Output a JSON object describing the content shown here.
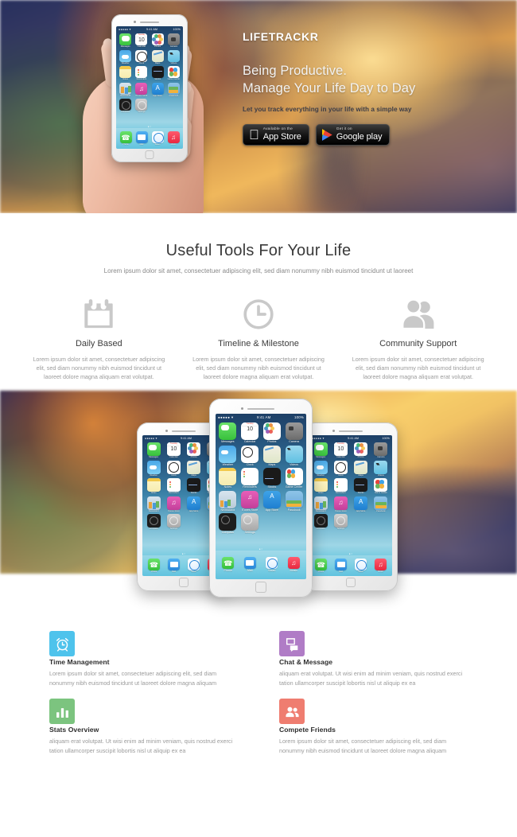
{
  "hero": {
    "brand": "LIFETRACKR",
    "headline_line1": "Being Productive.",
    "headline_line2": "Manage Your Life Day to Day",
    "subline": "Let you track everything in your life with a simple way",
    "app_store": {
      "small": "Available on the",
      "big": "App Store",
      "icon": "apple-icon"
    },
    "google_play": {
      "small": "Get it on",
      "big": "Google play",
      "icon": "google-play-icon"
    },
    "phone_image": "hand-holding-iphone"
  },
  "ios_screen": {
    "status_left": "●●●●● ▾",
    "status_time": "9:41 AM",
    "status_right": "100%",
    "page_dots": "● ○",
    "calendar_day": "10",
    "calendar_weekday": "Tuesday",
    "apps": [
      {
        "label": "Messages",
        "icon": "messages-icon"
      },
      {
        "label": "Calendar",
        "icon": "calendar-icon"
      },
      {
        "label": "Photos",
        "icon": "photos-icon"
      },
      {
        "label": "Camera",
        "icon": "camera-icon"
      },
      {
        "label": "Weather",
        "icon": "weather-icon"
      },
      {
        "label": "Clock",
        "icon": "clock-icon"
      },
      {
        "label": "Maps",
        "icon": "maps-icon"
      },
      {
        "label": "Videos",
        "icon": "videos-icon"
      },
      {
        "label": "Notes",
        "icon": "notes-icon"
      },
      {
        "label": "Reminders",
        "icon": "reminders-icon"
      },
      {
        "label": "Stocks",
        "icon": "stocks-icon"
      },
      {
        "label": "Game Center",
        "icon": "game-center-icon"
      },
      {
        "label": "Newsstand",
        "icon": "newsstand-icon"
      },
      {
        "label": "iTunes Store",
        "icon": "itunes-store-icon"
      },
      {
        "label": "App Store",
        "icon": "app-store-icon"
      },
      {
        "label": "Passbook",
        "icon": "passbook-icon"
      },
      {
        "label": "Compass",
        "icon": "compass-icon"
      },
      {
        "label": "Settings",
        "icon": "settings-icon"
      }
    ],
    "dock": [
      {
        "label": "Phone",
        "icon": "phone-icon"
      },
      {
        "label": "Mail",
        "icon": "mail-icon"
      },
      {
        "label": "Safari",
        "icon": "safari-icon"
      },
      {
        "label": "Music",
        "icon": "music-icon"
      }
    ]
  },
  "tools": {
    "title": "Useful Tools For Your Life",
    "lead": "Lorem ipsum dolor sit amet, consectetuer adipiscing elit, sed diam nonummy nibh euismod tincidunt ut laoreet",
    "items": [
      {
        "icon": "calendar-outline-icon",
        "title": "Daily Based",
        "text": "Lorem ipsum dolor sit amet, consectetuer adipiscing elit, sed diam nonummy nibh euismod tincidunt ut laoreet dolore magna aliquam erat volutpat."
      },
      {
        "icon": "clock-outline-icon",
        "title": "Timeline & Milestone",
        "text": "Lorem ipsum dolor sit amet, consectetuer adipiscing elit, sed diam nonummy nibh euismod tincidunt ut laoreet dolore magna aliquam erat volutpat."
      },
      {
        "icon": "users-icon",
        "title": "Community Support",
        "text": "Lorem ipsum dolor sit amet, consectetuer adipiscing elit, sed diam nonummy nibh euismod tincidunt ut laoreet dolore magna aliquam erat volutpat."
      }
    ]
  },
  "showcase": {
    "image": "three-iphones-home-screen"
  },
  "features": [
    {
      "icon": "alarm-clock-icon",
      "color": "#4ec3ec",
      "title": "Time Management",
      "text": "Lorem ipsum dolor sit amet, consectetuer adipiscing elit, sed diam nonummy nibh euismod tincidunt ut laoreet dolore magna aliquam"
    },
    {
      "icon": "chat-bubble-icon",
      "color": "#b07cc6",
      "title": "Chat & Message",
      "text": "aliquam erat volutpat. Ut wisi enim ad minim veniam, quis nostrud exerci tation ullamcorper suscipit lobortis nisl ut aliquip ex ea"
    },
    {
      "icon": "bar-chart-icon",
      "color": "#7cc47f",
      "title": "Stats Overview",
      "text": "aliquam erat volutpat. Ut wisi enim ad minim veniam, quis nostrud exerci tation ullamcorper suscipit lobortis nisl ut aliquip ex ea"
    },
    {
      "icon": "friends-icon",
      "color": "#ef7d70",
      "title": "Compete Friends",
      "text": "Lorem ipsum dolor sit amet, consectetuer adipiscing elit, sed diam nonummy nibh euismod tincidunt ut laoreet dolore magna aliquam"
    }
  ]
}
